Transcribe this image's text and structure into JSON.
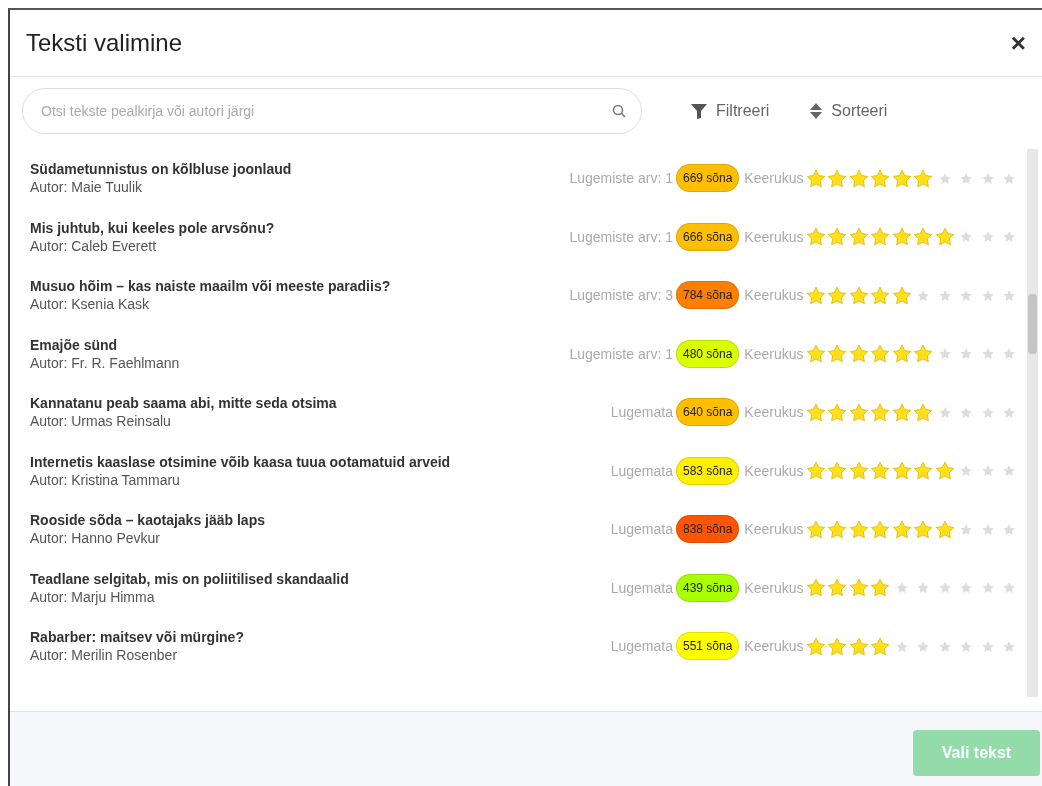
{
  "dialog": {
    "title": "Teksti valimine",
    "close": "×"
  },
  "search": {
    "placeholder": "Otsi tekste pealkirja või autori järgi"
  },
  "toolbar": [
    {
      "kind": "filter",
      "label": "Filtreeri"
    },
    {
      "kind": "sort",
      "label": "Sorteeri"
    }
  ],
  "texts": [
    {
      "title": "Südametunnistus on kõlbluse joonlaud",
      "author": "Autor: Maie Tuulik",
      "reads": "Lugemiste arv: 1",
      "words": "669 sõna",
      "color": "#ffbf00",
      "difficulty_label": "Keerukus",
      "stars": 6
    },
    {
      "title": "Mis juhtub, kui keeles pole arvsõnu?",
      "author": "Autor: Caleb Everett",
      "reads": "Lugemiste arv: 1",
      "words": "666 sõna",
      "color": "#ffbf00",
      "difficulty_label": "Keerukus",
      "stars": 7
    },
    {
      "title": "Musuo hõim – kas naiste maailm või meeste paradiis?",
      "author": "Autor: Ksenia Kask",
      "reads": "Lugemiste arv: 3",
      "words": "784 sõna",
      "color": "#ff7f00",
      "difficulty_label": "Keerukus",
      "stars": 5
    },
    {
      "title": "Emajõe sünd",
      "author": "Autor: Fr. R. Faehlmann",
      "reads": "Lugemiste arv: 1",
      "words": "480 sõna",
      "color": "#d9ff00",
      "difficulty_label": "Keerukus",
      "stars": 6
    },
    {
      "title": "Kannatanu peab saama abi, mitte seda otsima",
      "author": "Autor: Urmas Reinsalu",
      "reads": "Lugemata",
      "words": "640 sõna",
      "color": "#ffbf00",
      "difficulty_label": "Keerukus",
      "stars": 6
    },
    {
      "title": "Internetis kaaslase otsimine võib kaasa tuua ootamatuid arveid",
      "author": "Autor: Kristina Tammaru",
      "reads": "Lugemata",
      "words": "583 sõna",
      "color": "#ffef00",
      "difficulty_label": "Keerukus",
      "stars": 7
    },
    {
      "title": "Rooside sõda – kaotajaks jääb laps",
      "author": "Autor: Hanno Pevkur",
      "reads": "Lugemata",
      "words": "838 sõna",
      "color": "#ff5500",
      "difficulty_label": "Keerukus",
      "stars": 7
    },
    {
      "title": "Teadlane selgitab, mis on poliitilised skandaalid",
      "author": "Autor: Marju Himma",
      "reads": "Lugemata",
      "words": "439 sõna",
      "color": "#aaff00",
      "difficulty_label": "Keerukus",
      "stars": 4
    },
    {
      "title": "Rabarber: maitsev või mürgine?",
      "author": "Autor: Merilin Rosenber",
      "reads": "Lugemata",
      "words": "551 sõna",
      "color": "#ffff00",
      "difficulty_label": "Keerukus",
      "stars": 4
    }
  ],
  "footer": {
    "button": {
      "label": "Vali tekst",
      "disabled": true
    }
  }
}
